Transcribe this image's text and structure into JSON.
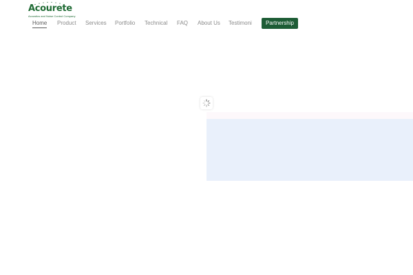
{
  "brand": {
    "name": "Acourete",
    "tagline": "Acoustics and Noise Control Company",
    "color": "#1f6b34"
  },
  "nav": {
    "items": [
      {
        "label": "Home",
        "active": true
      },
      {
        "label": "Product",
        "active": false
      },
      {
        "label": "Services",
        "active": false
      },
      {
        "label": "Portfolio",
        "active": false
      },
      {
        "label": "Technical",
        "active": false
      },
      {
        "label": "FAQ",
        "active": false
      },
      {
        "label": "About Us",
        "active": false
      },
      {
        "label": "Testimoni",
        "active": false
      }
    ],
    "cta_label": "Partnership",
    "cta_color": "#1d5c35"
  },
  "loader": {
    "icon": "spinner-icon"
  },
  "colors": {
    "panel": "#e9f0fb",
    "strip": "#fdf8fb",
    "nav_text": "#8a8a8a"
  }
}
